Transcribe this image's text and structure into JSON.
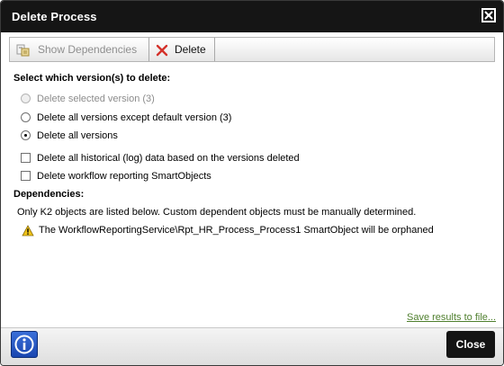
{
  "window": {
    "title": "Delete Process"
  },
  "toolbar": {
    "show_dependencies_label": "Show Dependencies",
    "delete_label": "Delete"
  },
  "versions": {
    "heading": "Select which version(s) to delete:",
    "options": [
      {
        "label": "Delete selected version (3)",
        "selected": false,
        "enabled": false
      },
      {
        "label": "Delete all versions except default version (3)",
        "selected": false,
        "enabled": true
      },
      {
        "label": "Delete all versions",
        "selected": true,
        "enabled": true
      }
    ]
  },
  "checkboxes": [
    {
      "label": "Delete all historical (log) data based on the versions deleted",
      "checked": false
    },
    {
      "label": "Delete workflow reporting SmartObjects",
      "checked": false
    }
  ],
  "dependencies": {
    "heading": "Dependencies:",
    "note": "Only K2 objects are listed below. Custom dependent objects must be manually determined.",
    "items": [
      {
        "text": "The WorkflowReportingService\\Rpt_HR_Process_Process1 SmartObject will be orphaned"
      }
    ]
  },
  "save_link": "Save results to file...",
  "footer": {
    "close_label": "Close"
  },
  "colors": {
    "titlebar": "#151515",
    "link": "#4f7f2e",
    "info_button": "#1a46b0",
    "delete_icon": "#d4312a",
    "warning": "#f0c419"
  },
  "icons": {
    "title_close": "close-icon",
    "show_dependencies": "dependencies-icon",
    "delete": "delete-x-icon",
    "warning": "warning-icon",
    "info": "info-icon"
  }
}
